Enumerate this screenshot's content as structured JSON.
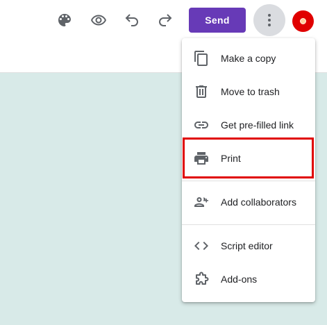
{
  "toolbar": {
    "icons": [
      "palette-icon",
      "eye-icon",
      "undo-icon",
      "redo-icon"
    ],
    "send_label": "Send",
    "send_color": "#673ab7",
    "more_icon": "more-vert-icon",
    "avatar_color": "#e00000"
  },
  "menu": {
    "items": [
      {
        "label": "Make a copy",
        "icon": "copy-icon"
      },
      {
        "label": "Move to trash",
        "icon": "trash-icon"
      },
      {
        "label": "Get pre-filled link",
        "icon": "link-icon"
      },
      {
        "label": "Print",
        "icon": "print-icon"
      },
      {
        "label": "Add collaborators",
        "icon": "add-people-icon"
      },
      {
        "label": "Script editor",
        "icon": "code-icon"
      },
      {
        "label": "Add-ons",
        "icon": "puzzle-icon"
      }
    ],
    "highlighted_item": "Print",
    "highlight_color": "#e00000"
  },
  "page": {
    "background_color": "#d8eae8"
  }
}
